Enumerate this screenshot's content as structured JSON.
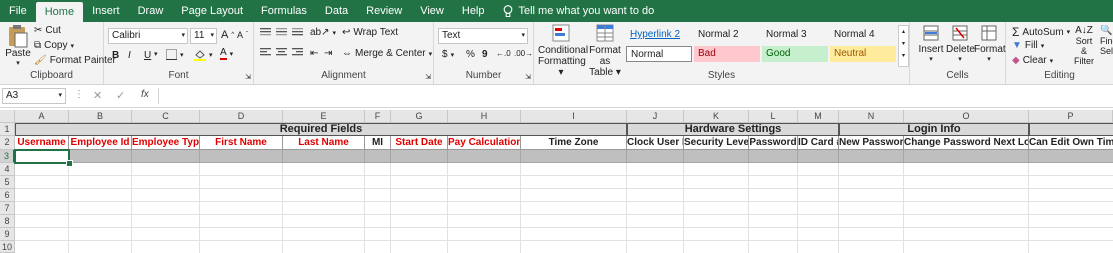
{
  "tabs": [
    "File",
    "Home",
    "Insert",
    "Draw",
    "Page Layout",
    "Formulas",
    "Data",
    "Review",
    "View",
    "Help"
  ],
  "tell_me": "Tell me what you want to do",
  "clipboard": {
    "paste": "Paste",
    "cut": "Cut",
    "copy": "Copy",
    "format_painter": "Format Painter",
    "label": "Clipboard"
  },
  "font": {
    "name": "Calibri",
    "size": "11",
    "label": "Font",
    "bold": "B",
    "italic": "I",
    "underline": "U"
  },
  "alignment": {
    "wrap_text": "Wrap Text",
    "merge_center": "Merge & Center",
    "label": "Alignment"
  },
  "number": {
    "format": "Text",
    "currency": "$",
    "percent": "%",
    "comma": "9",
    "label": "Number"
  },
  "styles": {
    "conditional": "Conditional",
    "formatting": "Formatting",
    "format_as": "Format as",
    "table": "Table",
    "hyperlink2": "Hyperlink 2",
    "normal2": "Normal 2",
    "normal3": "Normal 3",
    "normal4": "Normal 4",
    "normal": "Normal",
    "bad": "Bad",
    "good": "Good",
    "neutral": "Neutral",
    "label": "Styles"
  },
  "cells": {
    "insert": "Insert",
    "delete": "Delete",
    "format": "Format",
    "label": "Cells"
  },
  "editing": {
    "autosum": "AutoSum",
    "fill": "Fill",
    "clear": "Clear",
    "sort_filter": "Sort &",
    "filter": "Filter",
    "find": "Find",
    "select": "Sele",
    "label": "Editing"
  },
  "formula_bar": {
    "name_box": "A3",
    "fx": "fx",
    "value": ""
  },
  "columns": [
    "A",
    "B",
    "C",
    "D",
    "E",
    "F",
    "G",
    "H",
    "I",
    "J",
    "K",
    "L",
    "M",
    "N",
    "O",
    "P"
  ],
  "rows": [
    "1",
    "2",
    "3",
    "4",
    "5",
    "6",
    "7",
    "8",
    "9",
    "10"
  ],
  "group_headers": {
    "required": "Required Fields",
    "hardware": "Hardware Settings",
    "login": "Login Info"
  },
  "fields": [
    "Username",
    "Employee Id",
    "Employee Type",
    "First Name",
    "Last Name",
    "MI",
    "Start Date",
    "Pay Calculations",
    "Time Zone",
    "Clock User Id",
    "Security Level",
    "Password",
    "ID Card #",
    "New Password",
    "Change Password Next Logon",
    "Can Edit Own Time"
  ],
  "colors": {
    "excel_green": "#217346",
    "required_red": "#e00000",
    "header_gray": "#d9d9d9",
    "bad_bg": "#ffc7ce",
    "good_bg": "#c6efce",
    "neutral_bg": "#ffeb9c"
  }
}
